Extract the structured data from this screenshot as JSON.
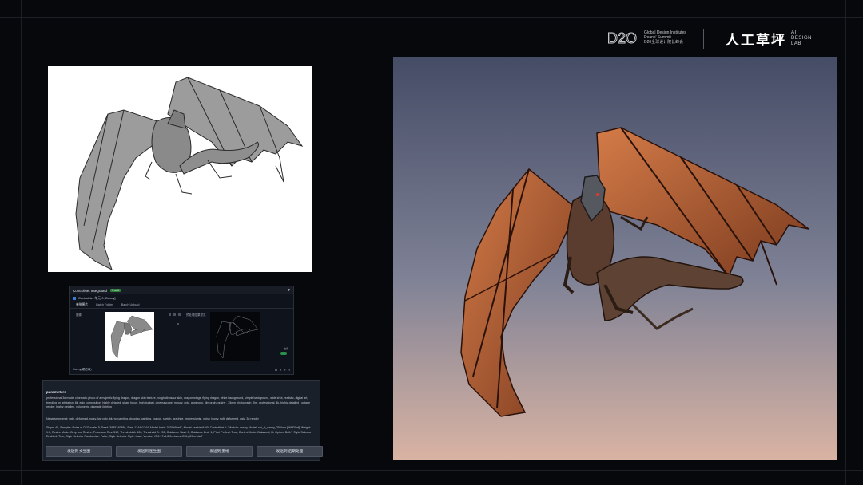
{
  "header": {
    "gdi_mark": "D2O",
    "gdi_line1": "Global Design Institutes",
    "gdi_line2": "Deans' Summit",
    "gdi_line3": "D20全球设计院长峰会",
    "lab_name": "人工草坪",
    "lab_sub1": "AI",
    "lab_sub2": "DESIGN",
    "lab_sub3": "LAB"
  },
  "controlnet": {
    "title": "ControlNet Integrated",
    "badge": "1 unit",
    "caret": "▼",
    "unit_label": "ControlNet 单元 0 [Canny]",
    "tabs": [
      "单张图片",
      "Batch Folder",
      "Batch Upload"
    ],
    "image_slot_label": "图像",
    "preview_label": "预处理结果预览",
    "toggle_label": "启用",
    "footer_text": "Canny(硬边缘)"
  },
  "parameters": {
    "title": "parameters",
    "positive_prompt": "professional 3d model cinematic photo of a majestic flying dragon, dragon skin texture, rough dinosaur skin, dragon wings, flying dragon, white background, simple background, wide shot, realistic, digital art, trending on artstation, 8k, epic composition, highly detailed, sharp focus, high budget, cinemascope, moody, epic, gorgeous, film grain, grainy . 35mm photograph, film, professional, 4k, highly detailed . octane render, highly detailed, volumetric, dramatic lighting",
    "negative_prompt": "Negative prompt: ugly, deformed, noisy, low poly, blurry, painting, drawing, painting, crayon, sketch, graphite, impressionist, noisy, blurry, soft, deformed, ugly, 3d render",
    "settings": "Steps: 40, Sampler: Euler a, CFG scale: 5, Seed: 3985140986, Size: 1344x1344, Model hash: 3839b56ef7, Model: realvisxlV40, ControlNet 0: \"Module: canny, Model: sai_xl_canny_256lora [566f20af], Weight: 1.0, Resize Mode: Crop and Resize, Processor Res: 512, Threshold A: 100, Threshold B: 200, Guidance Start: 0, Guidance End: 1, Pixel Perfect: True, Control Mode: Balanced, Hr Option: Both\", Style Selector Enabled: True, Style Selector Randomize: False, Style Selector Style: base, Version: f0.0.17v1.8.0rc-latest-276-g29be1da7",
    "buttons": [
      "发送到 文生图",
      "发送到 图生图",
      "发送到 重绘",
      "发送到 后期处理"
    ]
  }
}
